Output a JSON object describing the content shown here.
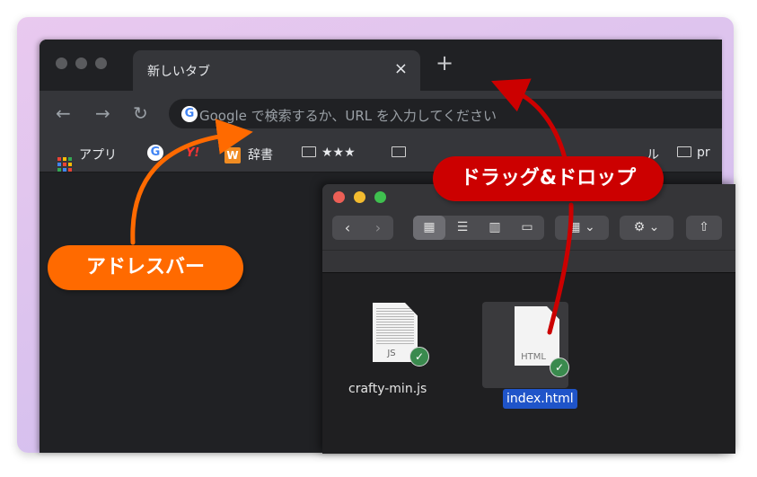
{
  "browser": {
    "tab": {
      "title": "新しいタブ",
      "close_icon": "×"
    },
    "new_tab_icon": "+",
    "toolbar": {
      "back_icon": "←",
      "forward_icon": "→",
      "reload_icon": "↻",
      "omnibox_placeholder": "Google で検索するか、URL を入力してください"
    },
    "bookmarks": [
      {
        "label": "アプリ",
        "icon": "apps-grid-icon"
      },
      {
        "label": "",
        "icon": "google-icon"
      },
      {
        "label": "",
        "icon": "yahoo-icon"
      },
      {
        "label": "辞書",
        "icon": "w-icon"
      },
      {
        "label": "★★★",
        "icon": "folder-icon"
      },
      {
        "label": "",
        "icon": "folder-icon"
      },
      {
        "label": "ル",
        "icon": ""
      },
      {
        "label": "pr",
        "icon": "folder-icon"
      }
    ]
  },
  "finder": {
    "files": [
      {
        "name": "crafty-min.js",
        "ext": "JS",
        "selected": false
      },
      {
        "name": "index.html",
        "ext": "HTML",
        "selected": true
      }
    ]
  },
  "callouts": {
    "address_bar": "アドレスバー",
    "drag_drop": "ドラッグ&ドロップ"
  },
  "colors": {
    "orange": "#ff6a00",
    "red": "#cc0000",
    "selection": "#1f54c9",
    "chrome_bg": "#202124"
  }
}
